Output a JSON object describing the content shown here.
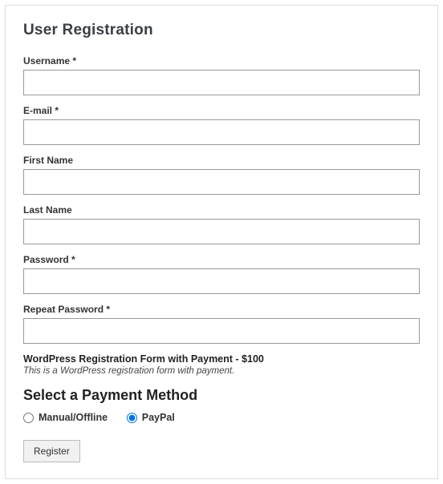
{
  "title": "User Registration",
  "fields": {
    "username": {
      "label": "Username *",
      "value": ""
    },
    "email": {
      "label": "E-mail *",
      "value": ""
    },
    "first": {
      "label": "First Name",
      "value": ""
    },
    "last": {
      "label": "Last Name",
      "value": ""
    },
    "password": {
      "label": "Password *",
      "value": ""
    },
    "repeat": {
      "label": "Repeat Password *",
      "value": ""
    }
  },
  "product": {
    "line": "WordPress Registration Form with Payment - $100",
    "desc": "This is a WordPress registration form with payment."
  },
  "payment": {
    "heading": "Select a Payment Method",
    "options": {
      "manual": "Manual/Offline",
      "paypal": "PayPal"
    },
    "selected": "paypal"
  },
  "submit_label": "Register"
}
